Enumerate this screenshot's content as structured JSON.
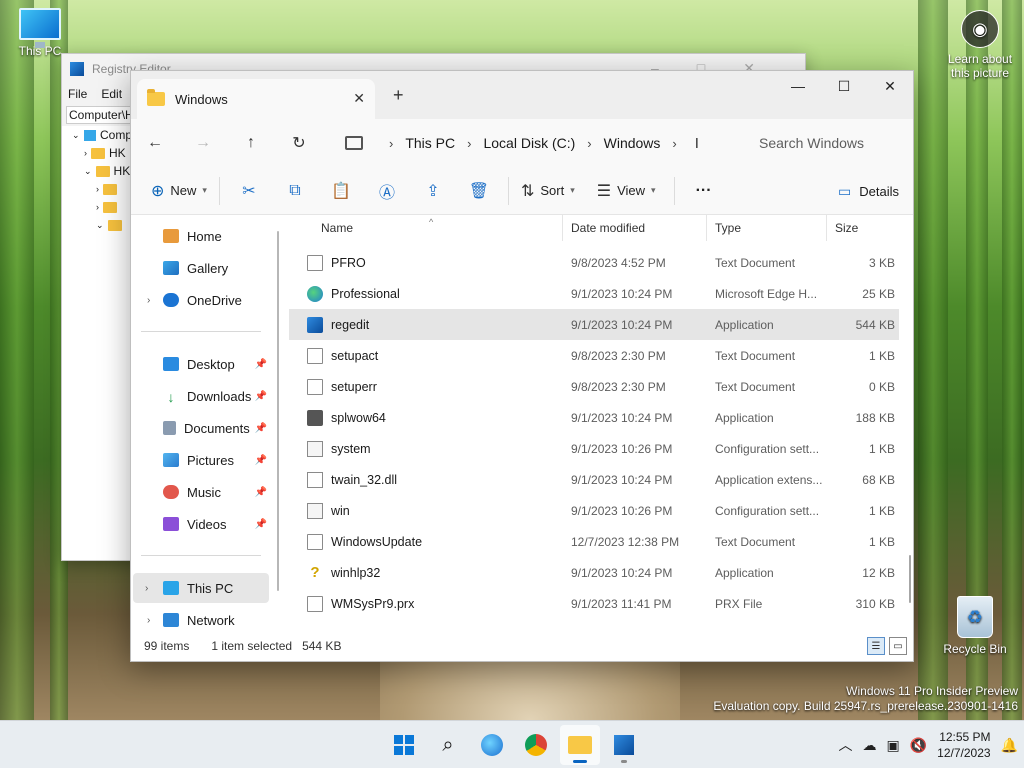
{
  "desktop": {
    "this_pc_label": "This PC",
    "learn_label": "Learn about this picture",
    "recycle_label": "Recycle Bin",
    "watermark_line1": "Windows 11 Pro Insider Preview",
    "watermark_line2": "Evaluation copy. Build 25947.rs_prerelease.230901-1416"
  },
  "regedit": {
    "title": "Registry Editor",
    "menu": [
      "File",
      "Edit"
    ],
    "address": "Computer\\H",
    "tree": [
      "Comp",
      "HK",
      "HK"
    ]
  },
  "explorer": {
    "tab_title": "Windows",
    "breadcrumb": [
      "This PC",
      "Local Disk (C:)",
      "Windows"
    ],
    "search_placeholder": "Search Windows",
    "commands": {
      "new": "New",
      "sort": "Sort",
      "view": "View",
      "details": "Details"
    },
    "sidebar": {
      "home": "Home",
      "gallery": "Gallery",
      "onedrive": "OneDrive",
      "desktop": "Desktop",
      "downloads": "Downloads",
      "documents": "Documents",
      "pictures": "Pictures",
      "music": "Music",
      "videos": "Videos",
      "this_pc": "This PC",
      "network": "Network"
    },
    "columns": [
      "Name",
      "Date modified",
      "Type",
      "Size"
    ],
    "files": [
      {
        "name": "PFRO",
        "date": "9/8/2023 4:52 PM",
        "type": "Text Document",
        "size": "3 KB",
        "icon": "text-document-icon"
      },
      {
        "name": "Professional",
        "date": "9/1/2023 10:24 PM",
        "type": "Microsoft Edge H...",
        "size": "25 KB",
        "icon": "edge-html-icon"
      },
      {
        "name": "regedit",
        "date": "9/1/2023 10:24 PM",
        "type": "Application",
        "size": "544 KB",
        "icon": "regedit-app-icon"
      },
      {
        "name": "setupact",
        "date": "9/8/2023 2:30 PM",
        "type": "Text Document",
        "size": "1 KB",
        "icon": "text-document-icon"
      },
      {
        "name": "setuperr",
        "date": "9/8/2023 2:30 PM",
        "type": "Text Document",
        "size": "0 KB",
        "icon": "text-document-icon"
      },
      {
        "name": "splwow64",
        "date": "9/1/2023 10:24 PM",
        "type": "Application",
        "size": "188 KB",
        "icon": "printer-app-icon"
      },
      {
        "name": "system",
        "date": "9/1/2023 10:26 PM",
        "type": "Configuration sett...",
        "size": "1 KB",
        "icon": "config-settings-icon"
      },
      {
        "name": "twain_32.dll",
        "date": "9/1/2023 10:24 PM",
        "type": "Application extens...",
        "size": "68 KB",
        "icon": "dll-icon"
      },
      {
        "name": "win",
        "date": "9/1/2023 10:26 PM",
        "type": "Configuration sett...",
        "size": "1 KB",
        "icon": "config-settings-icon"
      },
      {
        "name": "WindowsUpdate",
        "date": "12/7/2023 12:38 PM",
        "type": "Text Document",
        "size": "1 KB",
        "icon": "text-document-icon"
      },
      {
        "name": "winhlp32",
        "date": "9/1/2023 10:24 PM",
        "type": "Application",
        "size": "12 KB",
        "icon": "help-app-icon"
      },
      {
        "name": "WMSysPr9.prx",
        "date": "9/1/2023 11:41 PM",
        "type": "PRX File",
        "size": "310 KB",
        "icon": "generic-file-icon"
      }
    ],
    "selected_row": 2,
    "status": {
      "items": "99 items",
      "selected": "1 item selected",
      "size": "544 KB"
    }
  },
  "taskbar": {
    "time": "12:55 PM",
    "date": "12/7/2023"
  }
}
